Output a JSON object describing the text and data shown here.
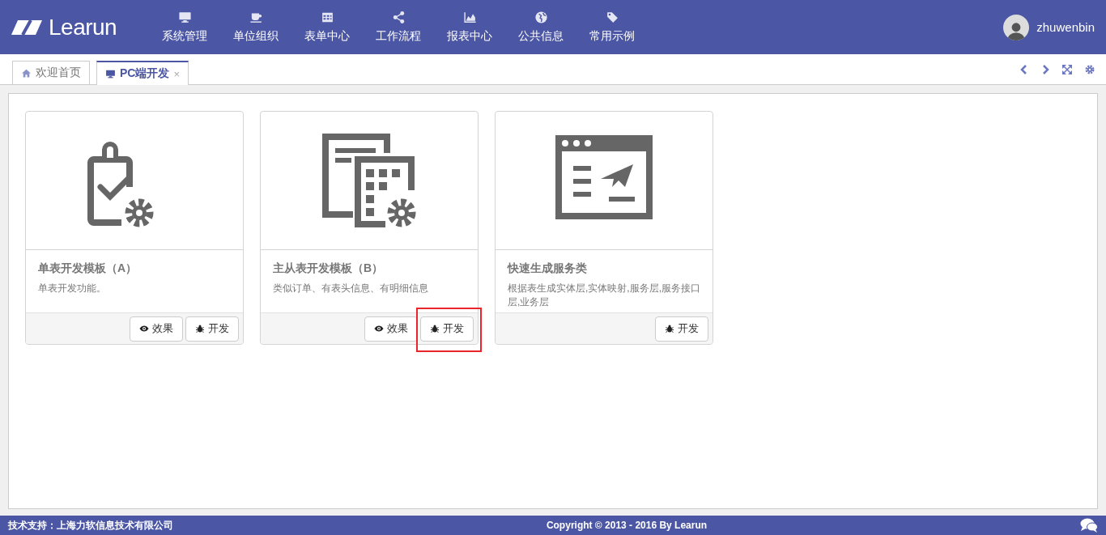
{
  "header": {
    "logo": "Learun",
    "nav": [
      {
        "label": "系统管理"
      },
      {
        "label": "单位组织"
      },
      {
        "label": "表单中心"
      },
      {
        "label": "工作流程"
      },
      {
        "label": "报表中心"
      },
      {
        "label": "公共信息"
      },
      {
        "label": "常用示例"
      }
    ],
    "user": "zhuwenbin"
  },
  "tabs": [
    {
      "label": "欢迎首页",
      "selected": false
    },
    {
      "label": "PC端开发",
      "selected": true,
      "close": "×"
    }
  ],
  "cards": [
    {
      "title": "单表开发模板（A）",
      "description": "单表开发功能。",
      "buttons": [
        {
          "kind": "preview",
          "label": "效果",
          "highlighted": false
        },
        {
          "kind": "develop",
          "label": "开发",
          "highlighted": false
        }
      ]
    },
    {
      "title": "主从表开发模板（B）",
      "description": "类似订单、有表头信息、有明细信息",
      "buttons": [
        {
          "kind": "preview",
          "label": "效果",
          "highlighted": false
        },
        {
          "kind": "develop",
          "label": "开发",
          "highlighted": true
        }
      ]
    },
    {
      "title": "快速生成服务类",
      "description": "根据表生成实体层,实体映射,服务层,服务接口层,业务层",
      "buttons": [
        {
          "kind": "develop",
          "label": "开发",
          "highlighted": false
        }
      ]
    }
  ],
  "footer": {
    "support": "技术支持：上海力软信息技术有限公司",
    "copyright": "Copyright © 2013 - 2016 By Learun"
  }
}
